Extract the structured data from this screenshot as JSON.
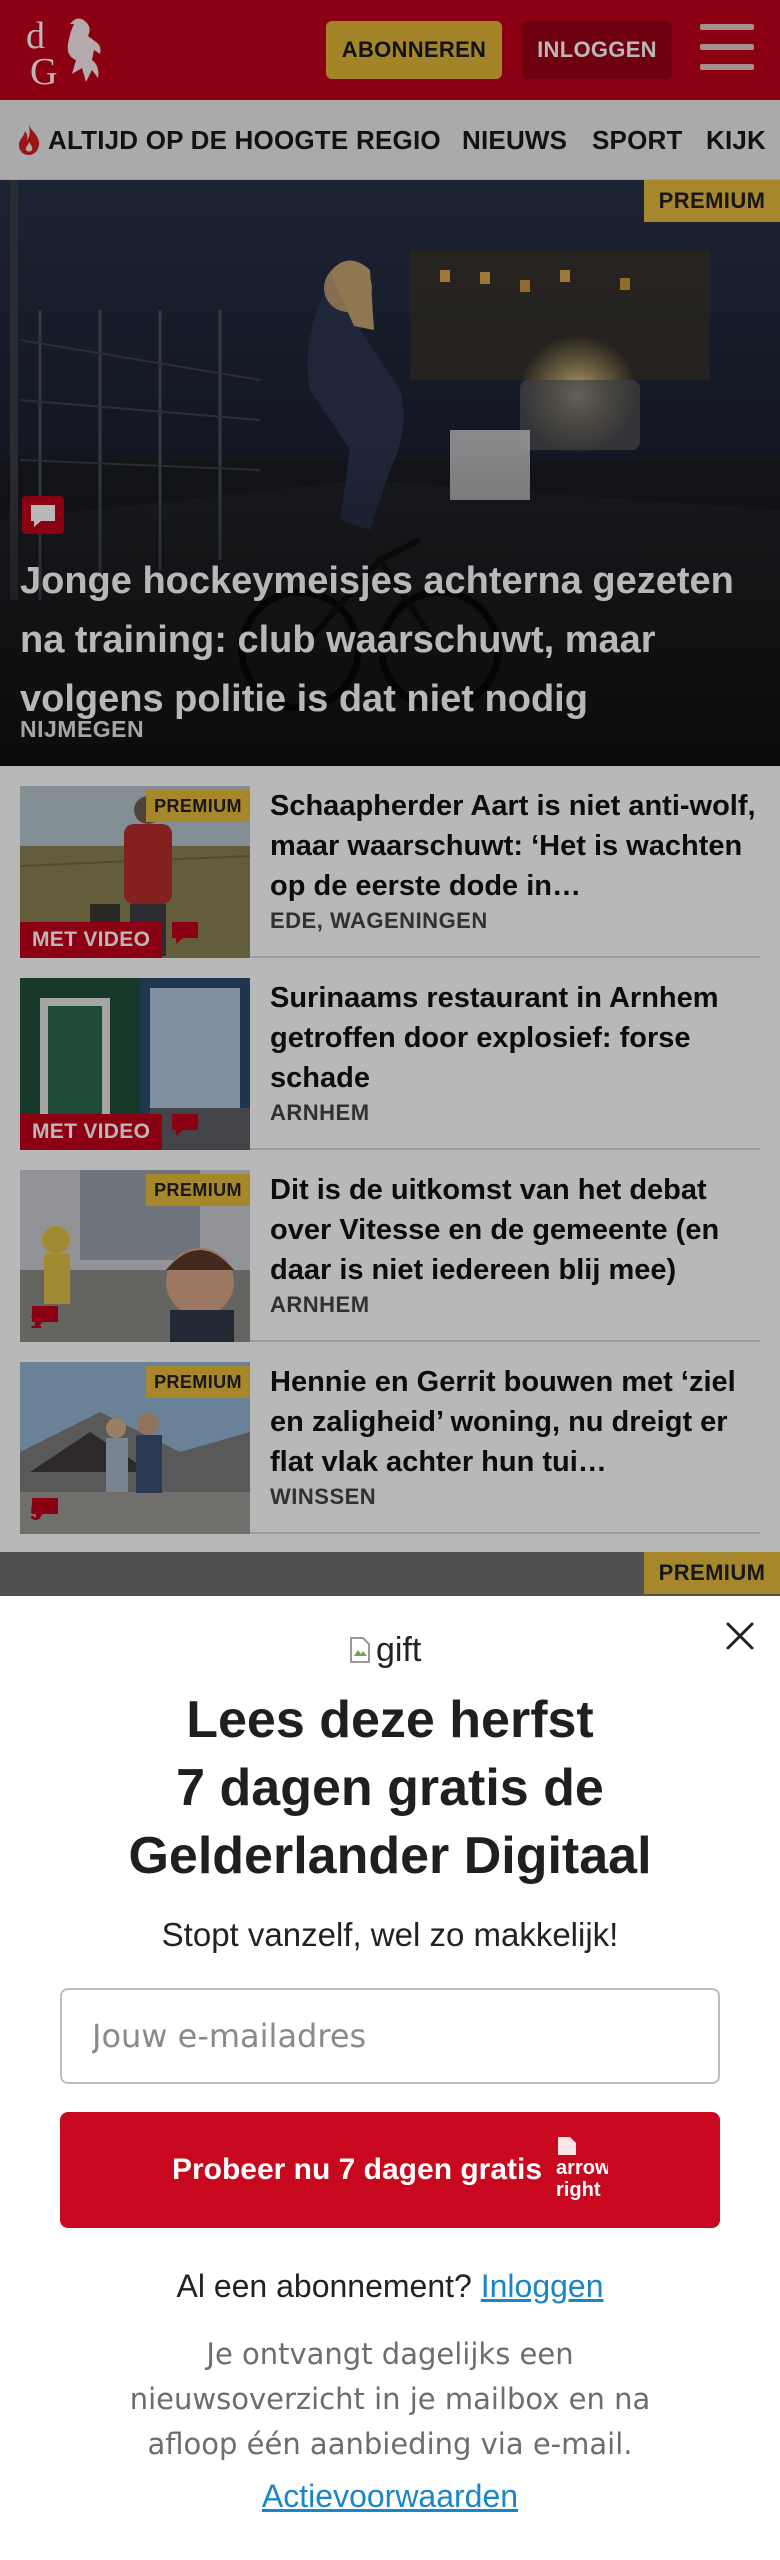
{
  "header": {
    "logo_text": "dG",
    "subscribe_label": "ABONNEREN",
    "login_label": "INLOGGEN",
    "colors": {
      "brand_red": "#c2001b",
      "gold": "#e2b83a"
    }
  },
  "nav": {
    "items": [
      {
        "label": "ALTIJD OP DE HOOGTE",
        "icon": "flame-icon"
      },
      {
        "label": "REGIO"
      },
      {
        "label": "NIEUWS"
      },
      {
        "label": "SPORT"
      },
      {
        "label": "KIJK"
      }
    ]
  },
  "hero": {
    "badge": "PREMIUM",
    "title": "Jonge hockeymeisjes achterna gezeten na training: club waarschuwt, maar volgens politie is dat niet nodig",
    "region": "NIJMEGEN",
    "icon": "comment-icon"
  },
  "articles": [
    {
      "title": "Schaapherder Aart is niet anti-wolf, maar waarschuwt: ‘Het is wachten op de eerste dode in…",
      "region": "EDE, WAGENINGEN",
      "premium_badge": "PREMIUM",
      "video_badge": "MET VIDEO",
      "comment_count": ""
    },
    {
      "title": "Surinaams restaurant in Arnhem getroffen door explosief: forse schade",
      "region": "ARNHEM",
      "premium_badge": "",
      "video_badge": "MET VIDEO",
      "comment_count": ""
    },
    {
      "title": "Dit is de uitkomst van het debat over Vitesse en de gemeente (en daar is niet iedereen blij mee)",
      "region": "ARNHEM",
      "premium_badge": "PREMIUM",
      "video_badge": "",
      "comment_count": "1"
    },
    {
      "title": "Hennie en Gerrit bouwen met ‘ziel en zaligheid’ woning, nu dreigt er flat vlak achter hun tui…",
      "region": "WINSSEN",
      "premium_badge": "PREMIUM",
      "video_badge": "",
      "comment_count": "5"
    }
  ],
  "next_article": {
    "premium_badge": "PREMIUM"
  },
  "modal": {
    "gift_alt": "gift",
    "title_line1": "Lees deze herfst",
    "title_line2": "7 dagen gratis de",
    "title_line3": "Gelderlander Digitaal",
    "subtitle": "Stopt vanzelf, wel zo makkelijk!",
    "email_placeholder": "Jouw e-mailadres",
    "cta_label": "Probeer nu 7 dagen gratis",
    "cta_arrow_alt": "arrow-right",
    "have_subscription_text": "Al een abonnement?",
    "have_subscription_link": "Inloggen",
    "info_text": "Je ontvangt dagelijks een nieuwsoverzicht in je mailbox en na afloop één aanbieding via e-mail.",
    "terms_link": "Actievoorwaarden",
    "colors": {
      "cta_red": "#c8081e",
      "link_blue": "#1a86c8"
    }
  }
}
